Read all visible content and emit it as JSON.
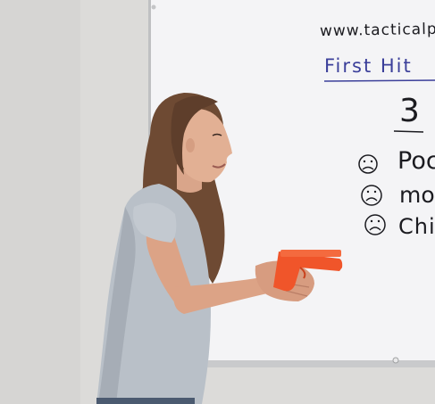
{
  "whiteboard": {
    "url_text": "www.tacticalp",
    "heading": "First Hit",
    "number": "3",
    "list_items": [
      {
        "icon": "frown-face-icon",
        "label": "Poc"
      },
      {
        "icon": "frown-face-icon",
        "label": "mot"
      },
      {
        "icon": "frown-face-icon",
        "label": "Chic"
      }
    ]
  },
  "colors": {
    "wall": "#dcdbd9",
    "whiteboard": "#f4f4f6",
    "marker_blue": "#3b3f9a",
    "marker_black": "#1b1b20",
    "training_pistol": "#f0552a",
    "shirt": "#b9c0c8"
  }
}
